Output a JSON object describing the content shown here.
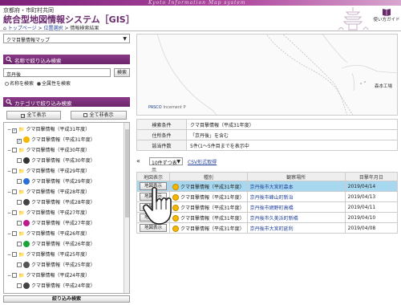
{
  "header": {
    "motto": "Kyoto Information Map system",
    "org": "京都府・市町村共同",
    "title": "統合型地図情報システム［GIS］",
    "guide_label": "使い方ガイド"
  },
  "breadcrumb": {
    "top": "トップページ",
    "sep1": " > ",
    "select": "位置選択",
    "sep2": " > ",
    "current": "情報検索結果"
  },
  "left": {
    "map_select": "クマ目撃情報マップ",
    "name_section": "名称で絞り込み検索",
    "name_value": "京丹後",
    "search_btn": "検索",
    "radio_name": "名称を検索",
    "radio_full": "全属性を検索",
    "category_section": "カテゴリで絞り込み検索",
    "show_all": "全て表示",
    "hide_all": "全て非表示",
    "filter_btn": "絞り込み検索",
    "tree": [
      {
        "label": "クマ目撃情報（平成31年度）",
        "child": false,
        "color": "#f5b800",
        "checked": true
      },
      {
        "label": "クマ目撃情報（平成31年度）",
        "child": true,
        "color": "#f5b800",
        "checked": true
      },
      {
        "label": "クマ目撃情報（平成30年度）",
        "child": false,
        "color": "#888",
        "checked": false
      },
      {
        "label": "クマ目撃情報（平成30年度）",
        "child": true,
        "color": "#333",
        "checked": false
      },
      {
        "label": "クマ目撃情報（平成29年度）",
        "child": false,
        "color": "#888",
        "checked": false
      },
      {
        "label": "クマ目撃情報（平成29年度）",
        "child": true,
        "color": "#2a6fd6",
        "checked": false
      },
      {
        "label": "クマ目撃情報（平成28年度）",
        "child": false,
        "color": "#888",
        "checked": false
      },
      {
        "label": "クマ目撃情報（平成28年度）",
        "child": true,
        "color": "#444",
        "checked": false
      },
      {
        "label": "クマ目撃情報（平成27年度）",
        "child": false,
        "color": "#888",
        "checked": false
      },
      {
        "label": "クマ目撃情報（平成27年度）",
        "child": true,
        "color": "#c0188f",
        "checked": false
      },
      {
        "label": "クマ目撃情報（平成26年度）",
        "child": false,
        "color": "#888",
        "checked": false
      },
      {
        "label": "クマ目撃情報（平成26年度）",
        "child": true,
        "color": "#1aa53a",
        "checked": false
      },
      {
        "label": "クマ目撃情報（平成25年度）",
        "child": false,
        "color": "#888",
        "checked": false
      },
      {
        "label": "クマ目撃情報（平成25年度）",
        "child": true,
        "color": "#555",
        "checked": false
      },
      {
        "label": "クマ目撃情報（平成24年度）",
        "child": false,
        "color": "#888",
        "checked": false
      },
      {
        "label": "クマ目撃情報（平成24年度）",
        "child": true,
        "color": "#444",
        "checked": false
      }
    ]
  },
  "map": {
    "credit": "PASCO",
    "credit2": "Incement P",
    "place": "森本工場"
  },
  "conditions": [
    {
      "key": "検索条件",
      "value": "クマ目撃情報（平成31年度）"
    },
    {
      "key": "住所条件",
      "value": "「京丹後」を含む"
    },
    {
      "key": "該当件数",
      "value": "5件(1〜5件目までを表示中"
    }
  ],
  "toolbar": {
    "per_page": "10件ずつ表示",
    "csv": "CSV形式取得"
  },
  "results": {
    "headers": [
      "地図表示",
      "種別",
      "観察場所",
      "目撃年月日"
    ],
    "rows": [
      {
        "btn": "地図表示",
        "type": "クマ目撃情報（平成31年度）",
        "place": "京丹後市大宮町森本",
        "date": "2019/04/14"
      },
      {
        "btn": "地図表示",
        "type": "クマ目撃情報（平成31年度）",
        "place": "京丹後市峰山町新治",
        "date": "2019/04/13"
      },
      {
        "btn": "地図表示",
        "type": "クマ目撃情報（平成31年度）",
        "place": "京丹後市網野町高橋",
        "date": "2019/04/11"
      },
      {
        "btn": "地図表示",
        "type": "クマ目撃情報（平成31年度）",
        "place": "京丹後市久美浜町新橋",
        "date": "2019/04/10"
      },
      {
        "btn": "地図表示",
        "type": "クマ目撃情報（平成31年度）",
        "place": "京丹後市大宮町延利",
        "date": "2019/04/08"
      }
    ]
  }
}
